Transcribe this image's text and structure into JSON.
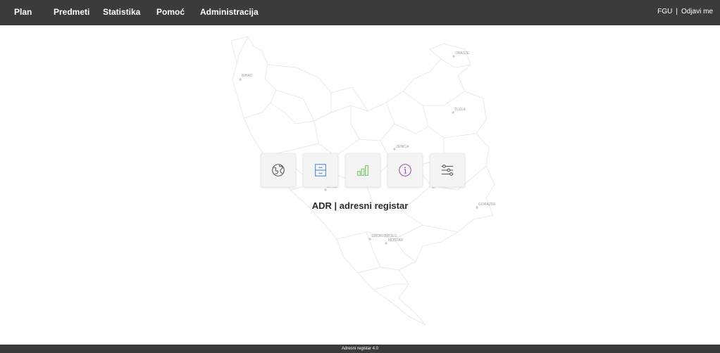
{
  "nav": {
    "items": [
      {
        "label": "Plan"
      },
      {
        "label": "Predmeti"
      },
      {
        "label": "Statistika"
      },
      {
        "label": "Pomoć"
      },
      {
        "label": "Administracija"
      }
    ]
  },
  "user": {
    "name": "FGU",
    "separator": "|",
    "logout_label": "Odjavi me"
  },
  "map": {
    "cities": [
      "BIHAC",
      "ORASJE",
      "TUZLA",
      "ZENICA",
      "LIVNO",
      "GORAZDE",
      "SIROKI BRIJEG",
      "MOSTAR"
    ]
  },
  "tiles": [
    {
      "icon": "globe-icon",
      "color": "#555555"
    },
    {
      "icon": "archive-drawer-icon",
      "color": "#4a90d9"
    },
    {
      "icon": "bar-chart-icon",
      "color": "#7cc46a"
    },
    {
      "icon": "info-icon",
      "color": "#9b4fb0"
    },
    {
      "icon": "sliders-icon",
      "color": "#555555"
    }
  ],
  "app": {
    "title": "ADR | adresni registar"
  },
  "footer": {
    "text": "Adresni registar 4.0"
  }
}
